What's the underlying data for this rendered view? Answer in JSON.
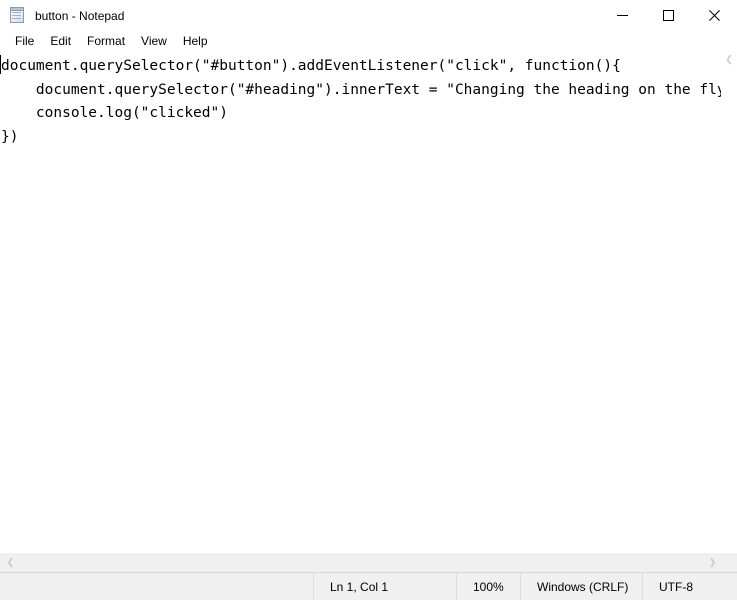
{
  "window": {
    "title": "button - Notepad",
    "icon": "notepad-icon",
    "controls": {
      "minimize": "minimize-icon",
      "maximize": "maximize-icon",
      "close": "close-icon"
    }
  },
  "menubar": {
    "items": [
      {
        "label": "File"
      },
      {
        "label": "Edit"
      },
      {
        "label": "Format"
      },
      {
        "label": "View"
      },
      {
        "label": "Help"
      }
    ]
  },
  "editor": {
    "content": "document.querySelector(\"#button\").addEventListener(\"click\", function(){\n    document.querySelector(\"#heading\").innerText = \"Changing the heading on the fly\"\n    console.log(\"clicked\")\n})",
    "lines": [
      "document.querySelector(\"#button\").addEventListener(\"click\", function(){",
      "    document.querySelector(\"#heading\").innerText = \"Changing the heading on the fly\"",
      "    console.log(\"clicked\")",
      "})"
    ],
    "caret_line": 1,
    "caret_column": 1
  },
  "scrollbars": {
    "horizontal": {
      "left_arrow": "chevron-left-icon",
      "right_arrow": "chevron-right-icon"
    },
    "vertical": {
      "up_arrow": "chevron-up-icon"
    }
  },
  "statusbar": {
    "position": "Ln 1, Col 1",
    "zoom": "100%",
    "line_ending": "Windows (CRLF)",
    "encoding": "UTF-8"
  },
  "colors": {
    "window_background": "#ffffff",
    "chrome_background": "#f0f0f0",
    "text": "#000000",
    "divider": "#dcdcdc",
    "scroll_arrow": "#c8c8c8"
  }
}
